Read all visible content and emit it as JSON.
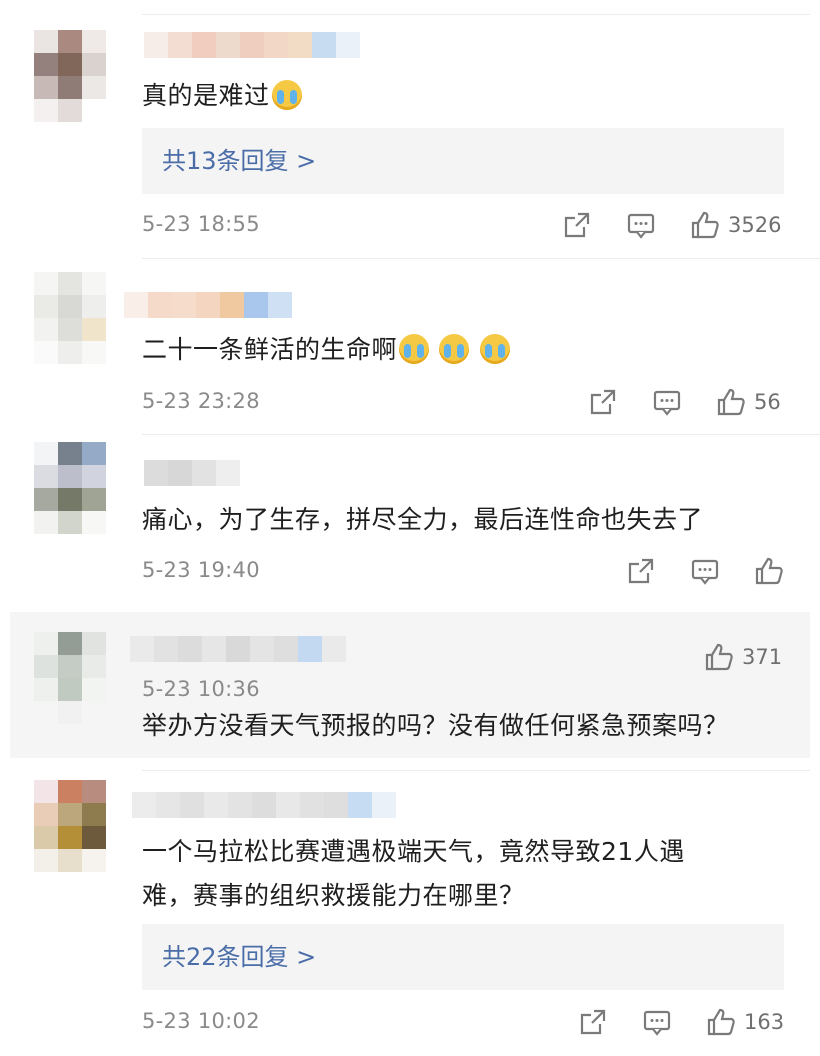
{
  "comments": [
    {
      "text": "真的是难过",
      "emoji_count": 1,
      "replies": "共13条回复 >",
      "date": "5-23 18:55",
      "likes": "3526"
    },
    {
      "text": "二十一条鲜活的生命啊",
      "emoji_count": 3,
      "date": "5-23 23:28",
      "likes": "56"
    },
    {
      "text": "痛心，为了生存，拼尽全力，最后连性命也失去了",
      "date": "5-23 19:40",
      "likes": ""
    },
    {
      "text": "举办方没看天气预报的吗？没有做任何紧急预案吗？",
      "date": "5-23 10:36",
      "likes": "371"
    },
    {
      "text_line1": "一个马拉松比赛遭遇极端天气，竟然导致21人遇",
      "text_line2": "难，赛事的组织救援能力在哪里？",
      "replies": "共22条回复 >",
      "date": "5-23 10:02",
      "likes": "163"
    }
  ],
  "icons": {
    "share": "share-icon",
    "comment": "comment-icon",
    "like": "thumbs-up-icon",
    "emoji": "crying-face-emoji"
  },
  "colors": {
    "reply_link": "#4a6da8",
    "meta_text": "#8a8a8a",
    "reply_bg": "#f4f4f5"
  }
}
